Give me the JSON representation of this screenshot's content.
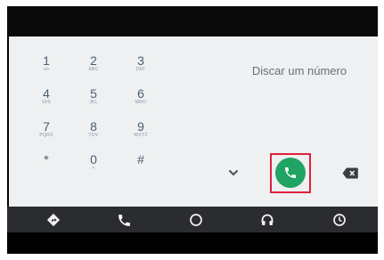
{
  "keypad": {
    "keys": [
      {
        "digit": "1",
        "letters": "oo"
      },
      {
        "digit": "2",
        "letters": "ABC"
      },
      {
        "digit": "3",
        "letters": "DEF"
      },
      {
        "digit": "4",
        "letters": "GHI"
      },
      {
        "digit": "5",
        "letters": "JKL"
      },
      {
        "digit": "6",
        "letters": "MNO"
      },
      {
        "digit": "7",
        "letters": "PQRS"
      },
      {
        "digit": "8",
        "letters": "TUV"
      },
      {
        "digit": "9",
        "letters": "WXYZ"
      },
      {
        "digit": "*",
        "letters": ""
      },
      {
        "digit": "0",
        "letters": "+"
      },
      {
        "digit": "#",
        "letters": ""
      }
    ]
  },
  "display": {
    "placeholder": "Discar um número"
  },
  "icons": {
    "collapse": "chevron-down-icon",
    "call": "phone-icon",
    "delete": "backspace-icon"
  },
  "navbar": {
    "items": [
      {
        "icon": "navigation-icon"
      },
      {
        "icon": "phone-icon",
        "active": true
      },
      {
        "icon": "home-circle-icon"
      },
      {
        "icon": "headphones-icon"
      },
      {
        "icon": "notifications-icon"
      }
    ]
  },
  "colors": {
    "call_green": "#1fa463",
    "highlight_red": "#e0203b",
    "navbar_bg": "#2a2c30",
    "dialer_bg": "#eef0f1"
  }
}
